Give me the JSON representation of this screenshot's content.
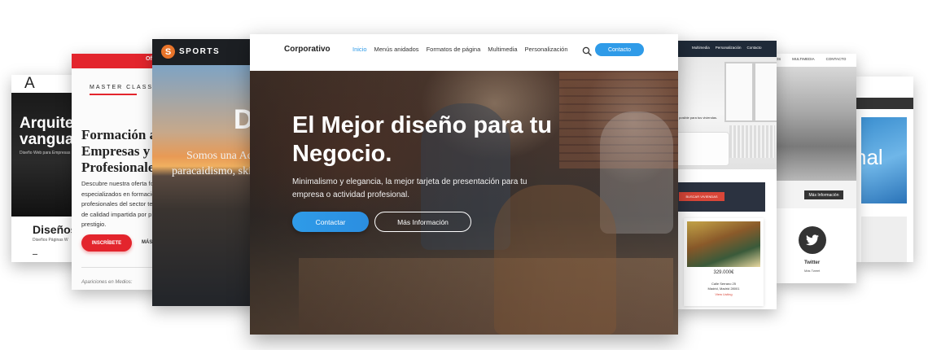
{
  "card_arquitectura": {
    "logo": "A",
    "title_line1": "Arquitec",
    "title_line2": "vanguar",
    "subtitle": "Diseño Web para Empresas y Pro",
    "heading": "Diseños",
    "text": "Diseños Páginas W",
    "footer": "..."
  },
  "card_masterclass": {
    "topbar_text": "Ofe",
    "brand": "MASTER CLASS",
    "title": "Formación a\nEmpresas y\nProfesionale",
    "description": "Descubre nuestra oferta for\nespecializados en formación\nprofesionales del sector te\nde calidad impartida por p\nprestigio.",
    "button": "INSCRÍBETE",
    "more": "MÁS",
    "media": "Apariciones en Medios:",
    "accent": "#e3252d"
  },
  "card_sports": {
    "logo_letter": "S",
    "brand": "SPORTS",
    "big_letter": "D",
    "line1": "Somos una Ac",
    "line2": "paracaidismo, ski"
  },
  "card_realestate": {
    "nav": [
      "Multimedia",
      "Personalización",
      "Contacto"
    ],
    "caption": "posible para tus viviendas.",
    "search_button": "BUSCAR VIVIENDAS",
    "price": "329.000€",
    "address": "Calle Serrano 25\nMadrid, Madrid 28001",
    "view_listing": "View Listing"
  },
  "card_nature": {
    "nav": [
      "TOS",
      "MULTIMEDIA",
      "CONTACTO"
    ],
    "button": "Más Información",
    "social_icon": "twitter-icon",
    "social_name": "Twitter",
    "social_sub": "Más Tweet"
  },
  "card_blue": {
    "text": "nal"
  },
  "main": {
    "brand": "Corporativo",
    "menu": [
      "Inicio",
      "Menús anidados",
      "Formatos de página",
      "Multimedia",
      "Personalización"
    ],
    "active_menu": "Inicio",
    "contact_button": "Contacto",
    "headline": "El Mejor diseño para tu Negocio.",
    "tagline": "Minimalismo y elegancia, la mejor tarjeta de presentación para tu empresa o actividad profesional.",
    "primary_button": "Contactar",
    "secondary_button": "Más Información",
    "accent": "#2f9be8"
  }
}
